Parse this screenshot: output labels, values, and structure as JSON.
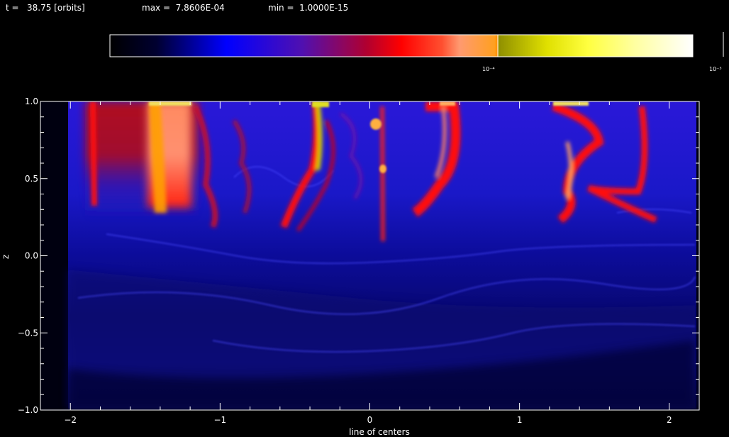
{
  "header": {
    "time_text": "t =   38.75 [orbits]",
    "max_text": "max =  7.8606E-04",
    "min_text": "min =  1.0000E-15"
  },
  "colorbar": {
    "tick_labels": [
      "10⁻⁴",
      "10⁻³"
    ]
  },
  "chart_data": {
    "type": "heatmap",
    "title": "",
    "xlabel": "line of centers",
    "ylabel": "z",
    "xlim": [
      -2.2,
      2.2
    ],
    "ylim": [
      -1.0,
      1.0
    ],
    "data_extent_x": [
      -2.02,
      2.02
    ],
    "x_ticks": [
      -2,
      -1,
      0,
      1,
      2
    ],
    "x_tick_labels": [
      "−2",
      "−1",
      "0",
      "1",
      "2"
    ],
    "y_ticks": [
      -1.0,
      -0.5,
      0.0,
      0.5,
      1.0
    ],
    "y_tick_labels": [
      "−1.0",
      "−0.5",
      "0.0",
      "0.5",
      "1.0"
    ],
    "value_range": [
      1e-15,
      0.00078606
    ],
    "colorscale": [
      "#000000",
      "#000040",
      "#0000ff",
      "#6010a0",
      "#c00020",
      "#ff0000",
      "#ff9060",
      "#ff9000",
      "#b0a000",
      "#ffff40",
      "#ffffff"
    ],
    "features": [
      {
        "x": -1.85,
        "z_bottom": 0.4,
        "z_top": 1.0,
        "level": "red"
      },
      {
        "x": -1.4,
        "z_bottom": 0.3,
        "z_top": 1.0,
        "level": "orange"
      },
      {
        "x": -0.45,
        "z_bottom": 0.18,
        "z_top": 1.0,
        "level": "yellow"
      },
      {
        "x": 0.0,
        "z_bottom": 0.05,
        "z_top": 1.0,
        "level": "red"
      },
      {
        "x": 0.35,
        "z_bottom": 0.25,
        "z_top": 1.0,
        "level": "red"
      },
      {
        "x": 1.25,
        "z_bottom": 0.25,
        "z_top": 1.0,
        "level": "orange"
      },
      {
        "x": 1.6,
        "z_bottom": 0.25,
        "z_top": 1.0,
        "level": "red"
      }
    ]
  }
}
